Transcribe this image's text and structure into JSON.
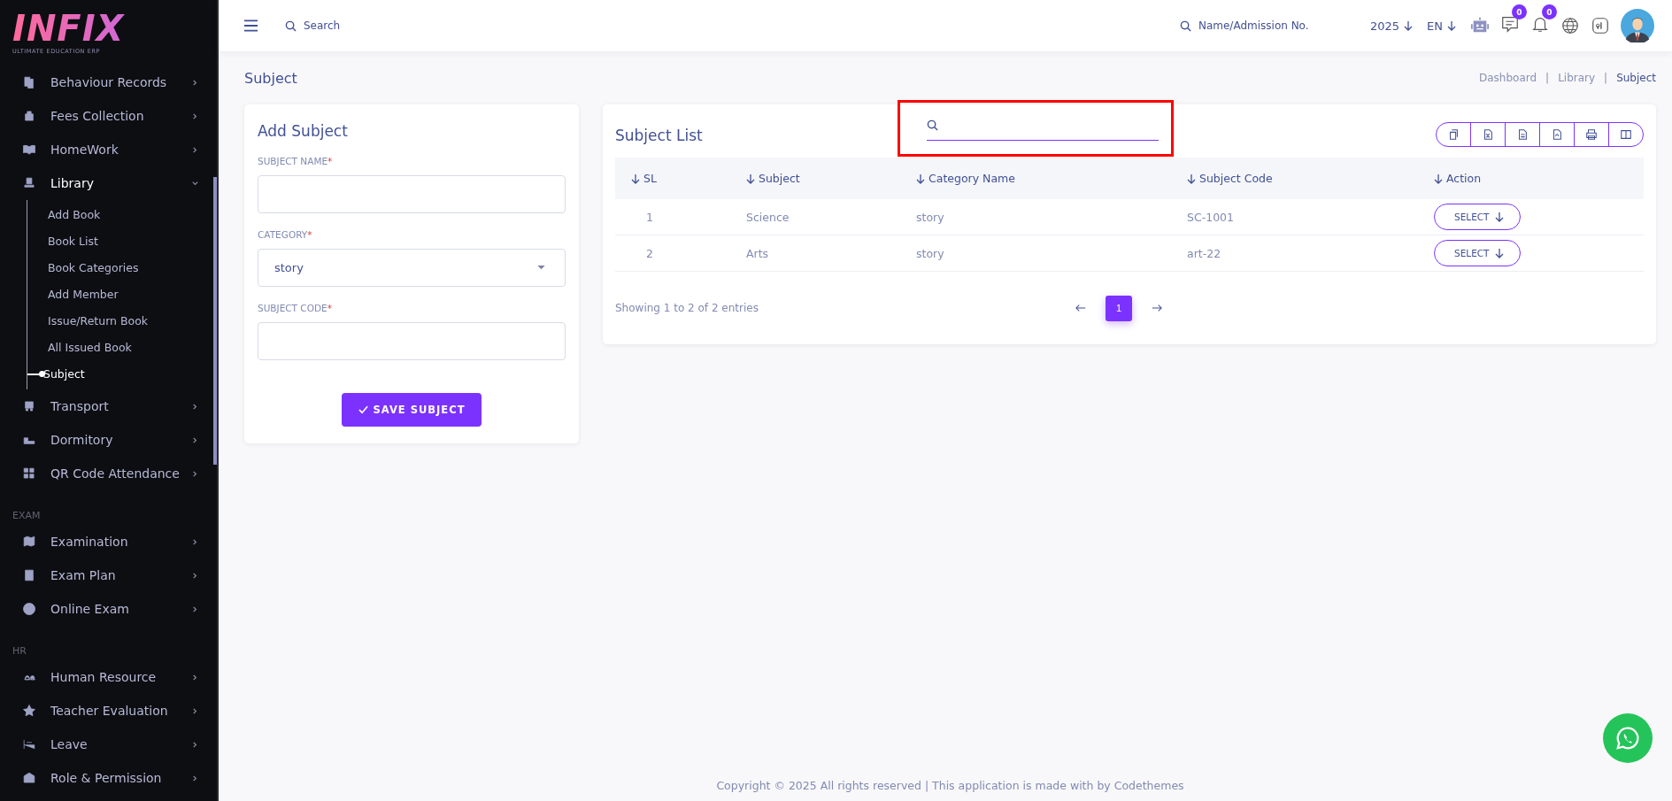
{
  "brand": {
    "logo": "INFIX",
    "tagline": "ULTIMATE EDUCATION ERP"
  },
  "sidebar": {
    "sections": [
      {
        "items": [
          {
            "label": "Behaviour Records",
            "expanded": false
          },
          {
            "label": "Fees Collection",
            "expanded": false
          },
          {
            "label": "HomeWork",
            "expanded": false
          },
          {
            "label": "Library",
            "expanded": true,
            "children": [
              {
                "label": "Add Book",
                "selected": false
              },
              {
                "label": "Book List",
                "selected": false
              },
              {
                "label": "Book Categories",
                "selected": false
              },
              {
                "label": "Add Member",
                "selected": false
              },
              {
                "label": "Issue/Return Book",
                "selected": false
              },
              {
                "label": "All Issued Book",
                "selected": false
              },
              {
                "label": "Subject",
                "selected": true
              }
            ]
          },
          {
            "label": "Transport",
            "expanded": false
          },
          {
            "label": "Dormitory",
            "expanded": false
          },
          {
            "label": "QR Code Attendance",
            "expanded": false
          }
        ]
      },
      {
        "heading": "EXAM",
        "items": [
          {
            "label": "Examination",
            "expanded": false
          },
          {
            "label": "Exam Plan",
            "expanded": false
          },
          {
            "label": "Online Exam",
            "expanded": false
          }
        ]
      },
      {
        "heading": "HR",
        "items": [
          {
            "label": "Human Resource",
            "expanded": false
          },
          {
            "label": "Teacher Evaluation",
            "expanded": false
          },
          {
            "label": "Leave",
            "expanded": false
          },
          {
            "label": "Role & Permission",
            "expanded": false
          }
        ]
      }
    ]
  },
  "header": {
    "search": {
      "placeholder": "Search"
    },
    "student_search": {
      "placeholder": "Name/Admission No."
    },
    "year": "2025",
    "language": "EN",
    "chat_badge": "0",
    "notification_badge": "0"
  },
  "page": {
    "title": "Subject",
    "breadcrumb": [
      "Dashboard",
      "Library",
      "Subject"
    ],
    "breadcrumb_separator": "|"
  },
  "form": {
    "title": "Add Subject",
    "required_mark": "*",
    "fields": [
      {
        "kind": "text",
        "label": "SUBJECT NAME",
        "required": true
      },
      {
        "kind": "select",
        "label": "CATEGORY",
        "required": true,
        "value": "story"
      },
      {
        "kind": "text",
        "label": "SUBJECT CODE",
        "required": true
      }
    ],
    "submit": "SAVE SUBJECT"
  },
  "table": {
    "title": "Subject List",
    "search": {
      "highlighted": true
    },
    "columns": [
      "SL",
      "Subject",
      "Category Name",
      "Subject Code",
      "Action"
    ],
    "rows": [
      {
        "cells": [
          "1",
          "Science",
          "story",
          "SC-1001"
        ],
        "action": "SELECT"
      },
      {
        "cells": [
          "2",
          "Arts",
          "story",
          "art-22"
        ],
        "action": "SELECT"
      }
    ],
    "info": "Showing 1 to 2 of 2 entries",
    "pages": [
      {
        "label": "1",
        "selected": true
      }
    ]
  },
  "footer": "Copyright © 2025 All rights reserved | This application is made with by Codethemes"
}
